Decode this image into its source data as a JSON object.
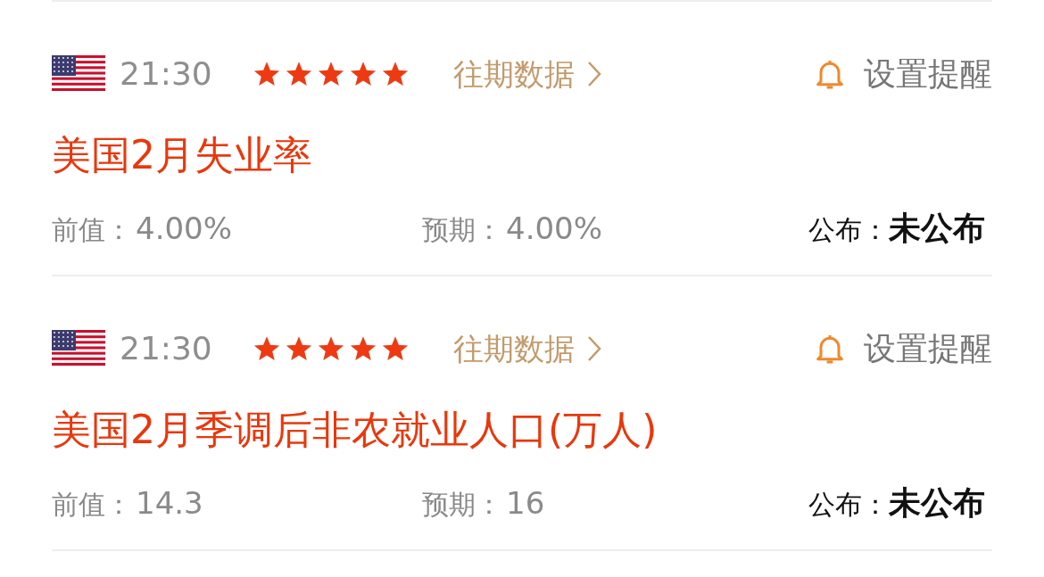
{
  "events": [
    {
      "time": "21:30",
      "stars": 5,
      "history_link": "往期数据",
      "reminder": "设置提醒",
      "title": "美国2月失业率",
      "previous_label": "前值：",
      "previous": "4.00%",
      "forecast_label": "预期：",
      "forecast": "4.00%",
      "publish_label": "公布：",
      "publish": "未公布"
    },
    {
      "time": "21:30",
      "stars": 5,
      "history_link": "往期数据",
      "reminder": "设置提醒",
      "title": "美国2月季调后非农就业人口(万人)",
      "previous_label": "前值：",
      "previous": "14.3",
      "forecast_label": "预期：",
      "forecast": "16",
      "publish_label": "公布：",
      "publish": "未公布"
    }
  ]
}
